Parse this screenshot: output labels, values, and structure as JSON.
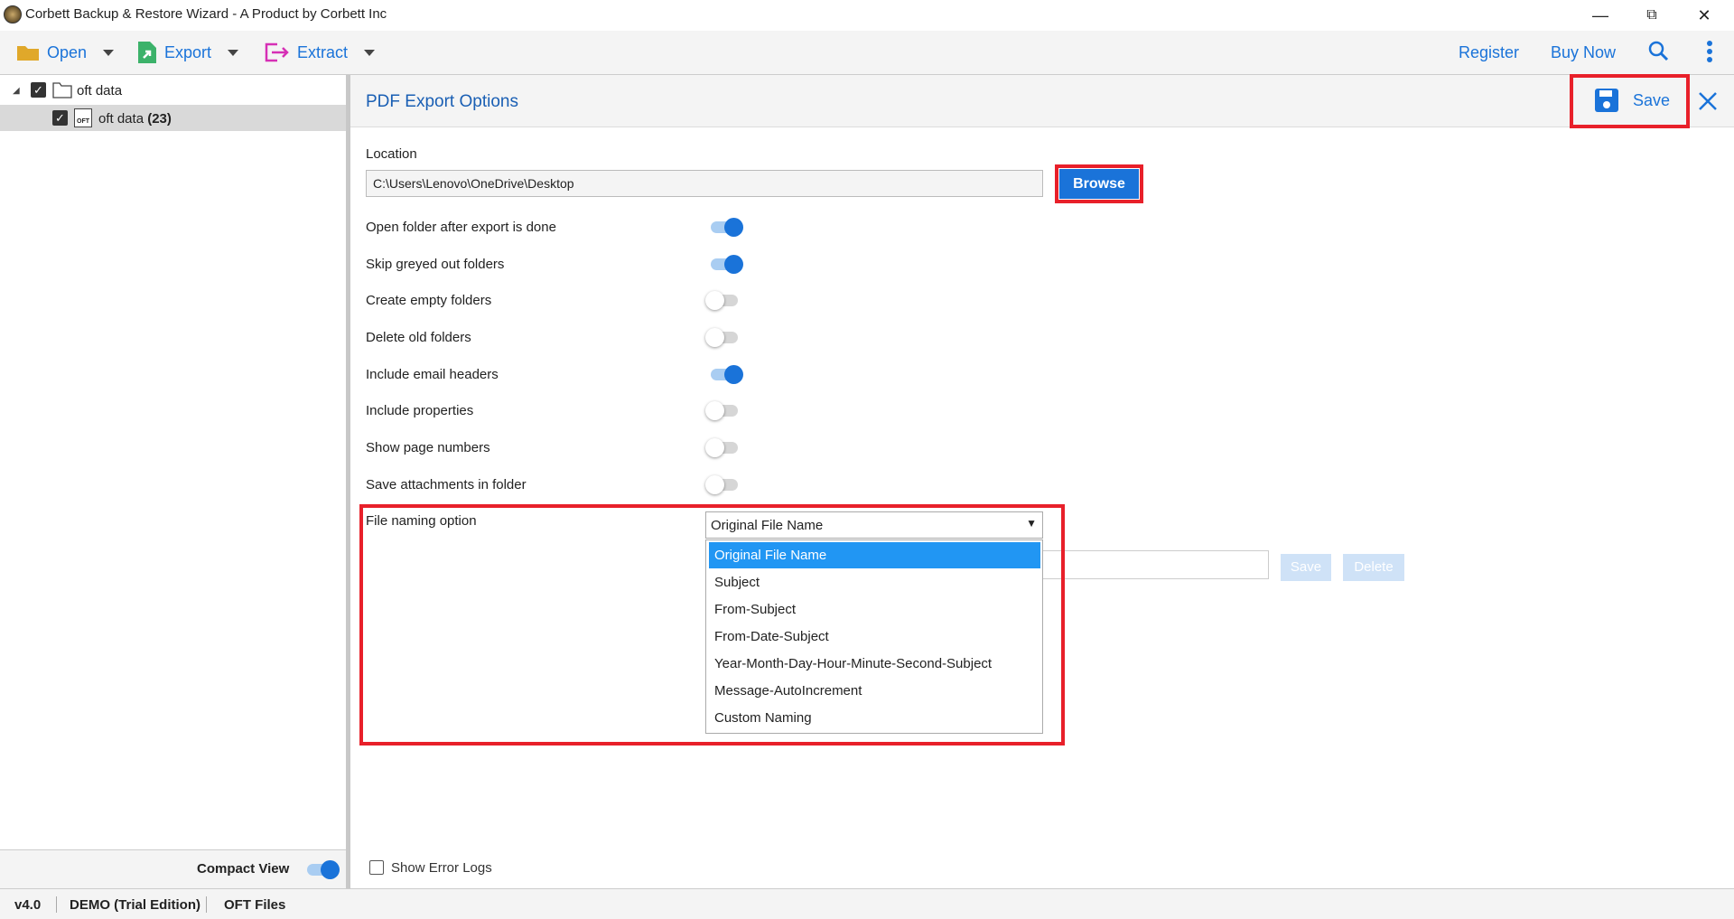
{
  "window": {
    "title": "Corbett Backup & Restore Wizard - A Product by Corbett Inc"
  },
  "toolbar": {
    "open": "Open",
    "export": "Export",
    "extract": "Extract",
    "register": "Register",
    "buy_now": "Buy Now"
  },
  "tree": {
    "root": "oft data",
    "child": "oft data",
    "child_count": "(23)",
    "child_icon_text": "OFT"
  },
  "panel": {
    "title": "PDF Export Options",
    "save": "Save"
  },
  "location": {
    "label": "Location",
    "value": "C:\\Users\\Lenovo\\OneDrive\\Desktop",
    "browse": "Browse"
  },
  "options": [
    {
      "label": "Open folder after export is done",
      "on": true
    },
    {
      "label": "Skip greyed out folders",
      "on": true
    },
    {
      "label": "Create empty folders",
      "on": false
    },
    {
      "label": "Delete old folders",
      "on": false
    },
    {
      "label": "Include email headers",
      "on": true
    },
    {
      "label": "Include properties",
      "on": false
    },
    {
      "label": "Show page numbers",
      "on": false
    },
    {
      "label": "Save attachments in folder",
      "on": false
    }
  ],
  "naming": {
    "label": "File naming option",
    "selected": "Original File Name",
    "options": [
      "Original File Name",
      "Subject",
      "From-Subject",
      "From-Date-Subject",
      "Year-Month-Day-Hour-Minute-Second-Subject",
      "Message-AutoIncrement",
      "Custom Naming"
    ],
    "save": "Save",
    "delete": "Delete"
  },
  "compact_view": {
    "label": "Compact View",
    "on": true
  },
  "error_logs": {
    "label": "Show Error Logs",
    "checked": false
  },
  "status": {
    "version": "v4.0",
    "edition": "DEMO (Trial Edition)",
    "type": "OFT Files"
  },
  "colors": {
    "accent": "#1a73d9",
    "highlight": "#2196f3",
    "red_box": "#e8202a"
  }
}
